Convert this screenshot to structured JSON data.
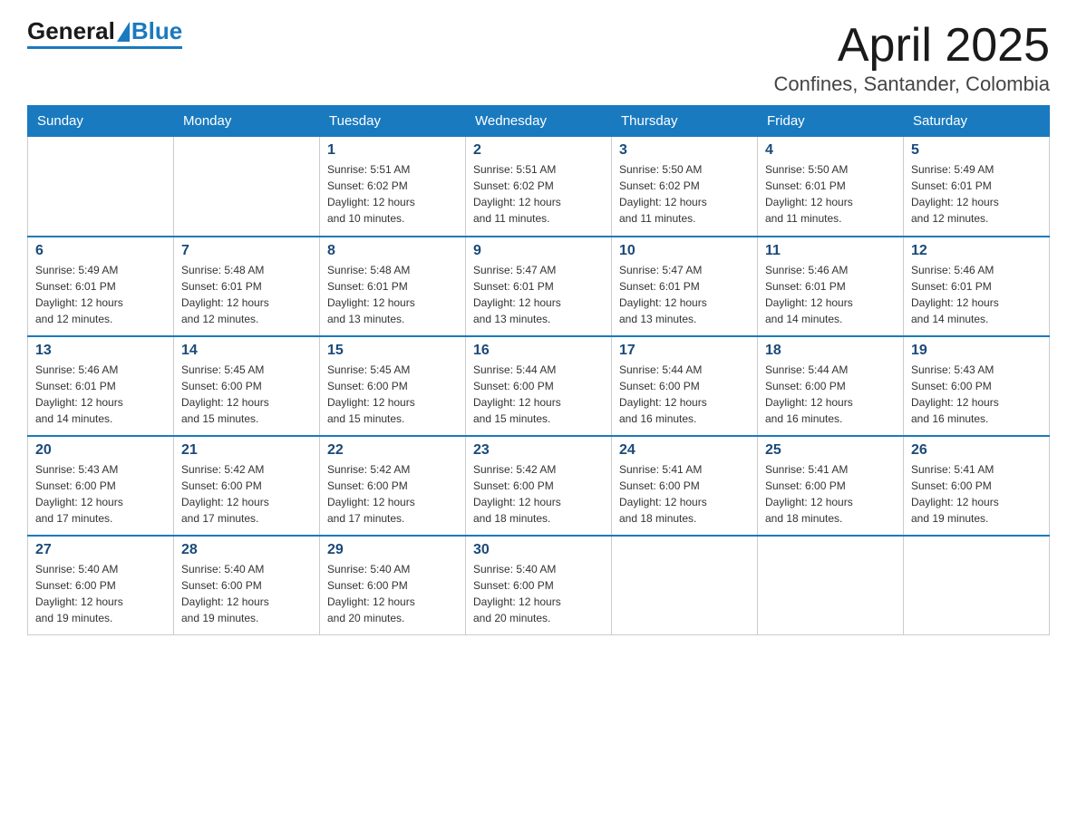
{
  "logo": {
    "general": "General",
    "blue": "Blue"
  },
  "title": "April 2025",
  "subtitle": "Confines, Santander, Colombia",
  "weekdays": [
    "Sunday",
    "Monday",
    "Tuesday",
    "Wednesday",
    "Thursday",
    "Friday",
    "Saturday"
  ],
  "weeks": [
    [
      {
        "day": "",
        "info": ""
      },
      {
        "day": "",
        "info": ""
      },
      {
        "day": "1",
        "info": "Sunrise: 5:51 AM\nSunset: 6:02 PM\nDaylight: 12 hours\nand 10 minutes."
      },
      {
        "day": "2",
        "info": "Sunrise: 5:51 AM\nSunset: 6:02 PM\nDaylight: 12 hours\nand 11 minutes."
      },
      {
        "day": "3",
        "info": "Sunrise: 5:50 AM\nSunset: 6:02 PM\nDaylight: 12 hours\nand 11 minutes."
      },
      {
        "day": "4",
        "info": "Sunrise: 5:50 AM\nSunset: 6:01 PM\nDaylight: 12 hours\nand 11 minutes."
      },
      {
        "day": "5",
        "info": "Sunrise: 5:49 AM\nSunset: 6:01 PM\nDaylight: 12 hours\nand 12 minutes."
      }
    ],
    [
      {
        "day": "6",
        "info": "Sunrise: 5:49 AM\nSunset: 6:01 PM\nDaylight: 12 hours\nand 12 minutes."
      },
      {
        "day": "7",
        "info": "Sunrise: 5:48 AM\nSunset: 6:01 PM\nDaylight: 12 hours\nand 12 minutes."
      },
      {
        "day": "8",
        "info": "Sunrise: 5:48 AM\nSunset: 6:01 PM\nDaylight: 12 hours\nand 13 minutes."
      },
      {
        "day": "9",
        "info": "Sunrise: 5:47 AM\nSunset: 6:01 PM\nDaylight: 12 hours\nand 13 minutes."
      },
      {
        "day": "10",
        "info": "Sunrise: 5:47 AM\nSunset: 6:01 PM\nDaylight: 12 hours\nand 13 minutes."
      },
      {
        "day": "11",
        "info": "Sunrise: 5:46 AM\nSunset: 6:01 PM\nDaylight: 12 hours\nand 14 minutes."
      },
      {
        "day": "12",
        "info": "Sunrise: 5:46 AM\nSunset: 6:01 PM\nDaylight: 12 hours\nand 14 minutes."
      }
    ],
    [
      {
        "day": "13",
        "info": "Sunrise: 5:46 AM\nSunset: 6:01 PM\nDaylight: 12 hours\nand 14 minutes."
      },
      {
        "day": "14",
        "info": "Sunrise: 5:45 AM\nSunset: 6:00 PM\nDaylight: 12 hours\nand 15 minutes."
      },
      {
        "day": "15",
        "info": "Sunrise: 5:45 AM\nSunset: 6:00 PM\nDaylight: 12 hours\nand 15 minutes."
      },
      {
        "day": "16",
        "info": "Sunrise: 5:44 AM\nSunset: 6:00 PM\nDaylight: 12 hours\nand 15 minutes."
      },
      {
        "day": "17",
        "info": "Sunrise: 5:44 AM\nSunset: 6:00 PM\nDaylight: 12 hours\nand 16 minutes."
      },
      {
        "day": "18",
        "info": "Sunrise: 5:44 AM\nSunset: 6:00 PM\nDaylight: 12 hours\nand 16 minutes."
      },
      {
        "day": "19",
        "info": "Sunrise: 5:43 AM\nSunset: 6:00 PM\nDaylight: 12 hours\nand 16 minutes."
      }
    ],
    [
      {
        "day": "20",
        "info": "Sunrise: 5:43 AM\nSunset: 6:00 PM\nDaylight: 12 hours\nand 17 minutes."
      },
      {
        "day": "21",
        "info": "Sunrise: 5:42 AM\nSunset: 6:00 PM\nDaylight: 12 hours\nand 17 minutes."
      },
      {
        "day": "22",
        "info": "Sunrise: 5:42 AM\nSunset: 6:00 PM\nDaylight: 12 hours\nand 17 minutes."
      },
      {
        "day": "23",
        "info": "Sunrise: 5:42 AM\nSunset: 6:00 PM\nDaylight: 12 hours\nand 18 minutes."
      },
      {
        "day": "24",
        "info": "Sunrise: 5:41 AM\nSunset: 6:00 PM\nDaylight: 12 hours\nand 18 minutes."
      },
      {
        "day": "25",
        "info": "Sunrise: 5:41 AM\nSunset: 6:00 PM\nDaylight: 12 hours\nand 18 minutes."
      },
      {
        "day": "26",
        "info": "Sunrise: 5:41 AM\nSunset: 6:00 PM\nDaylight: 12 hours\nand 19 minutes."
      }
    ],
    [
      {
        "day": "27",
        "info": "Sunrise: 5:40 AM\nSunset: 6:00 PM\nDaylight: 12 hours\nand 19 minutes."
      },
      {
        "day": "28",
        "info": "Sunrise: 5:40 AM\nSunset: 6:00 PM\nDaylight: 12 hours\nand 19 minutes."
      },
      {
        "day": "29",
        "info": "Sunrise: 5:40 AM\nSunset: 6:00 PM\nDaylight: 12 hours\nand 20 minutes."
      },
      {
        "day": "30",
        "info": "Sunrise: 5:40 AM\nSunset: 6:00 PM\nDaylight: 12 hours\nand 20 minutes."
      },
      {
        "day": "",
        "info": ""
      },
      {
        "day": "",
        "info": ""
      },
      {
        "day": "",
        "info": ""
      }
    ]
  ]
}
